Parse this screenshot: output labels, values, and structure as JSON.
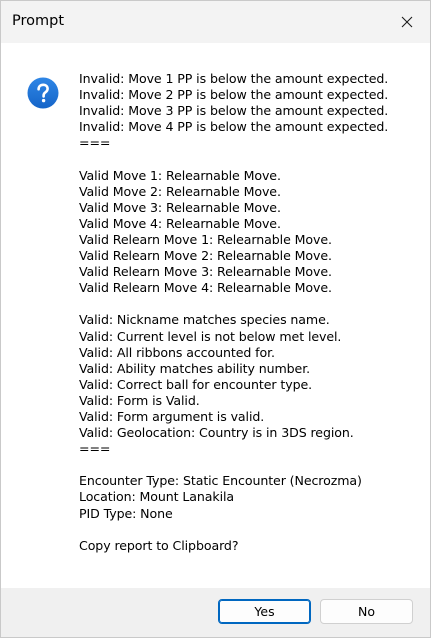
{
  "window": {
    "title": "Prompt"
  },
  "icons": {
    "dialog_icon": "question-icon",
    "close_icon": "close-icon"
  },
  "colors": {
    "accent": "#0067c0",
    "icon_blue": "#1e6fd9"
  },
  "message": {
    "text": "Invalid: Move 1 PP is below the amount expected.\nInvalid: Move 2 PP is below the amount expected.\nInvalid: Move 3 PP is below the amount expected.\nInvalid: Move 4 PP is below the amount expected.\n===\n\nValid Move 1: Relearnable Move.\nValid Move 2: Relearnable Move.\nValid Move 3: Relearnable Move.\nValid Move 4: Relearnable Move.\nValid Relearn Move 1: Relearnable Move.\nValid Relearn Move 2: Relearnable Move.\nValid Relearn Move 3: Relearnable Move.\nValid Relearn Move 4: Relearnable Move.\n\nValid: Nickname matches species name.\nValid: Current level is not below met level.\nValid: All ribbons accounted for.\nValid: Ability matches ability number.\nValid: Correct ball for encounter type.\nValid: Form is Valid.\nValid: Form argument is valid.\nValid: Geolocation: Country is in 3DS region.\n===\n\nEncounter Type: Static Encounter (Necrozma)\nLocation: Mount Lanakila\nPID Type: None\n\nCopy report to Clipboard?"
  },
  "buttons": {
    "yes_label": "Yes",
    "no_label": "No"
  }
}
